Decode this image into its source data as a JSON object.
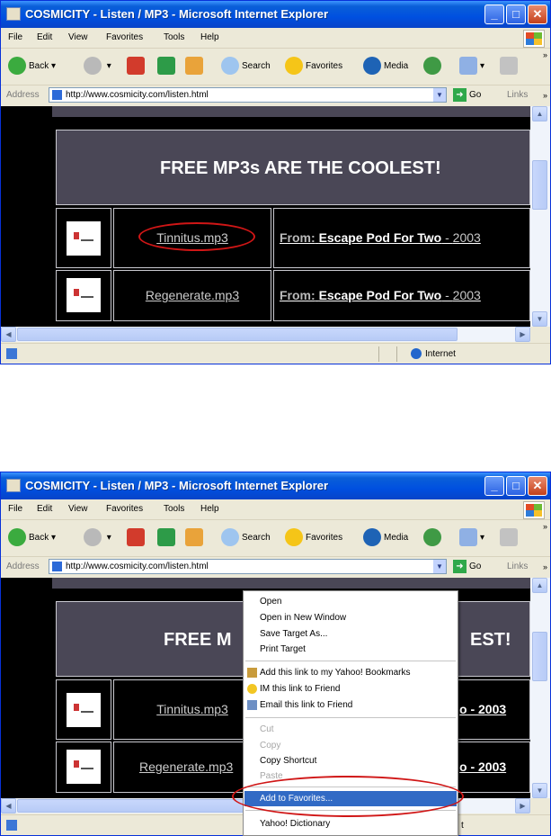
{
  "window": {
    "title": "COSMICITY - Listen / MP3 - Microsoft Internet Explorer"
  },
  "menu": [
    "File",
    "Edit",
    "View",
    "Favorites",
    "Tools",
    "Help"
  ],
  "toolbar": {
    "back": "Back",
    "search": "Search",
    "favorites": "Favorites",
    "media": "Media"
  },
  "address": {
    "label": "Address",
    "url": "http://www.cosmicity.com/listen.html",
    "go": "Go",
    "links": "Links"
  },
  "page": {
    "heading": "FREE MP3s ARE THE COOLEST!",
    "heading_partial_left": "FREE M",
    "heading_partial_right": "EST!",
    "from_label": "From:",
    "rows": [
      {
        "song": "Tinnitus.mp3",
        "album": "Escape Pod For Two",
        "year": "2003",
        "year_partial": "o - 2003"
      },
      {
        "song": "Regenerate.mp3",
        "album": "Escape Pod For Two",
        "year": "2003",
        "year_partial": "o - 2003"
      }
    ],
    "song2_partial": "Regenerate.mp3"
  },
  "status": {
    "zone": "Internet",
    "zone_partial": "t"
  },
  "context_menu": {
    "items": [
      {
        "label": "Open",
        "disabled": false
      },
      {
        "label": "Open in New Window",
        "disabled": false
      },
      {
        "label": "Save Target As...",
        "disabled": false
      },
      {
        "label": "Print Target",
        "disabled": false
      },
      {
        "label": "Add this link to my Yahoo! Bookmarks",
        "disabled": false,
        "icon": "yahoo-bookmark-icon"
      },
      {
        "label": "IM this link to Friend",
        "disabled": false,
        "icon": "messenger-icon"
      },
      {
        "label": "Email this link to Friend",
        "disabled": false,
        "icon": "email-icon"
      },
      {
        "label": "Cut",
        "disabled": true
      },
      {
        "label": "Copy",
        "disabled": true
      },
      {
        "label": "Copy Shortcut",
        "disabled": false
      },
      {
        "label": "Paste",
        "disabled": true
      },
      {
        "label": "Add to Favorites...",
        "disabled": false,
        "highlighted": true
      },
      {
        "label": "Yahoo! Dictionary",
        "disabled": false
      }
    ]
  },
  "colors": {
    "titlebar": "#0050e0",
    "page_bg": "#000000",
    "header_cell": "#4a4756",
    "highlight": "#316ac5",
    "annotation_oval": "#d01616"
  }
}
